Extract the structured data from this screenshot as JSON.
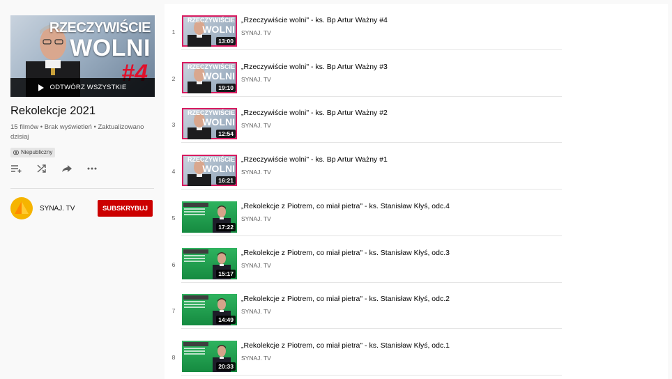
{
  "sidebar": {
    "playall_label": "ODTWÓRZ WSZYSTKIE",
    "hero_line1": "RZECZYWIŚCIE",
    "hero_line2": "WOLNI",
    "hero_line3": "#4",
    "playlist_title": "Rekolekcje 2021",
    "playlist_meta": "15 filmów • Brak wyświetleń • Zaktualizowano dzisiaj",
    "privacy_label": "Niepubliczny",
    "channel_name": "SYNAJ. TV",
    "subscribe_label": "SUBSKRYBUJ"
  },
  "thumb_text": {
    "line1": "RZECZYWIŚCIE",
    "line2": "WOLNI"
  },
  "videos": [
    {
      "index": "1",
      "title": "„Rzeczywiście wolni\" - ks. Bp Artur Ważny #4",
      "channel": "SYNAJ. TV",
      "duration": "13:00",
      "thumb": "red"
    },
    {
      "index": "2",
      "title": "„Rzeczywiście wolni\" - ks. Bp Artur Ważny #3",
      "channel": "SYNAJ. TV",
      "duration": "19:10",
      "thumb": "red"
    },
    {
      "index": "3",
      "title": "„Rzeczywiście wolni\" - ks. Bp Artur Ważny #2",
      "channel": "SYNAJ. TV",
      "duration": "12:54",
      "thumb": "red"
    },
    {
      "index": "4",
      "title": "„Rzeczywiście wolni\" - ks. Bp Artur Ważny #1",
      "channel": "SYNAJ. TV",
      "duration": "16:21",
      "thumb": "red"
    },
    {
      "index": "5",
      "title": "„Rekolekcje z Piotrem, co miał pietra\" - ks. Stanisław Kłyś, odc.4",
      "channel": "SYNAJ. TV",
      "duration": "17:22",
      "thumb": "green"
    },
    {
      "index": "6",
      "title": "„Rekolekcje z Piotrem, co miał pietra\" - ks. Stanisław Kłyś, odc.3",
      "channel": "SYNAJ. TV",
      "duration": "15:17",
      "thumb": "green"
    },
    {
      "index": "7",
      "title": "„Rekolekcje z Piotrem, co miał pietra\" - ks. Stanisław Kłyś, odc.2",
      "channel": "SYNAJ. TV",
      "duration": "14:49",
      "thumb": "green"
    },
    {
      "index": "8",
      "title": "„Rekolekcje z Piotrem, co miał pietra\" - ks. Stanisław Kłyś, odc.1",
      "channel": "SYNAJ. TV",
      "duration": "20:33",
      "thumb": "green"
    }
  ],
  "colors": {
    "subscribe": "#cc0000",
    "avatar": "#f6b400",
    "thumb_red_border": "#d81b60",
    "thumb_green": "#1e9e50"
  },
  "icons": [
    "play-icon",
    "add-to-queue-icon",
    "shuffle-icon",
    "share-icon",
    "more-icon",
    "link-icon"
  ]
}
